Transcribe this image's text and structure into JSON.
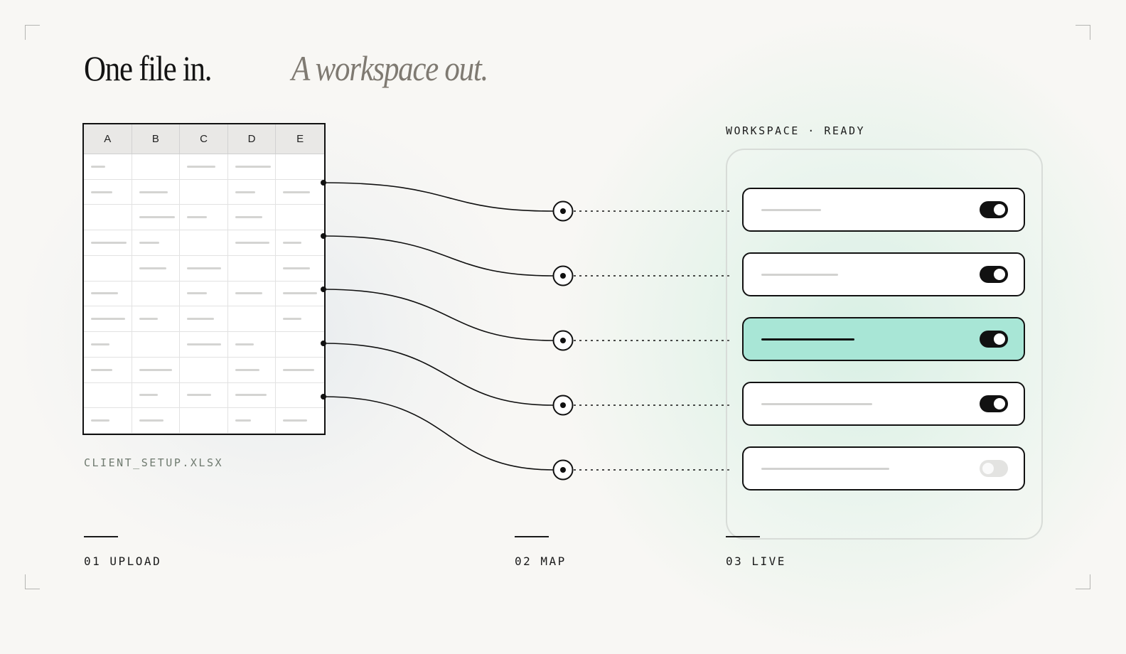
{
  "headline": {
    "lead": "One file in.",
    "tail": "A workspace out."
  },
  "spreadsheet": {
    "columns": [
      "A",
      "B",
      "C",
      "D",
      "E"
    ],
    "row_count": 11,
    "file_name": "CLIENT_SETUP.XLSX"
  },
  "workspace": {
    "label": "WORKSPACE · READY",
    "rows": [
      {
        "toggle_on": true,
        "highlighted": false
      },
      {
        "toggle_on": true,
        "highlighted": false
      },
      {
        "toggle_on": true,
        "highlighted": true
      },
      {
        "toggle_on": true,
        "highlighted": false
      },
      {
        "toggle_on": false,
        "highlighted": false
      }
    ]
  },
  "steps": [
    {
      "label": "01 UPLOAD"
    },
    {
      "label": "02 MAP"
    },
    {
      "label": "03 LIVE"
    }
  ],
  "colors": {
    "background": "#f8f7f4",
    "ink": "#111111",
    "muted_heading": "#7f7a72",
    "highlight_row": "#a8e6d6",
    "filename_text": "#6f7a6f"
  }
}
